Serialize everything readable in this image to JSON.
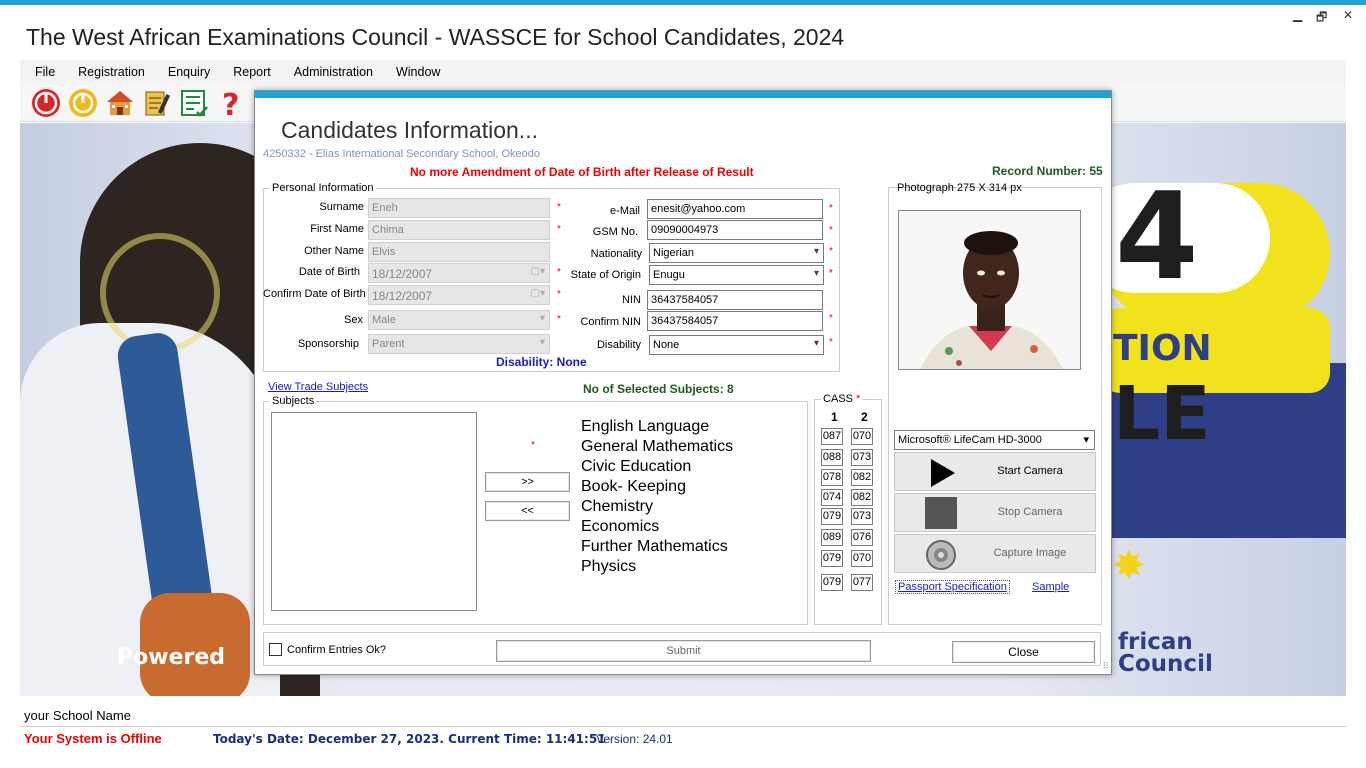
{
  "app": {
    "title": "The West African Examinations Council - WASSCE for School Candidates, 2024",
    "window_controls": [
      "▁",
      "🗗",
      "✕"
    ]
  },
  "menu": [
    "File",
    "Registration",
    "Enquiry",
    "Report",
    "Administration",
    "Window"
  ],
  "toolbar": {
    "icons": [
      "power-icon",
      "logoff-icon",
      "school-icon",
      "edit-form-icon",
      "checklist-icon",
      "help-icon"
    ]
  },
  "background": {
    "powered": "Powered",
    "digit": "4",
    "tion": "TION",
    "le": "LE",
    "council_line1": "frican",
    "council_line2": "Council"
  },
  "dialog": {
    "title": "Candidates Information...",
    "school": "4250332 - Elias International Secondary School, Okeodo",
    "warning": "No more Amendment of Date of Birth after Release of Result",
    "record_number": "Record Number: 55",
    "personal_legend": "Personal Information",
    "labels": {
      "surname": "Surname",
      "first_name": "First Name",
      "other_name": "Other Name",
      "dob": "Date of Birth",
      "confirm_dob": "Confirm Date of Birth",
      "sex": "Sex",
      "sponsorship": "Sponsorship",
      "email": "e-Mail",
      "gsm": "GSM No.",
      "nationality": "Nationality",
      "state": "State of Origin",
      "nin": "NIN",
      "confirm_nin": "Confirm NIN",
      "disability": "Disability"
    },
    "values": {
      "surname": "Eneh",
      "first_name": "Chima",
      "other_name": "Elvis",
      "dob": "18/12/2007",
      "confirm_dob": "18/12/2007",
      "sex": "Male",
      "sponsorship": "Parent",
      "email": "enesit@yahoo.com",
      "gsm": "09090004973",
      "nationality": "Nigerian",
      "state": "Enugu",
      "nin": "36437584057",
      "confirm_nin": "36437584057",
      "disability": "None"
    },
    "disability_summary": "Disability: None",
    "view_trade": "View Trade Subjects",
    "selected_count": "No of Selected Subjects: 8",
    "subjects_legend": "Subjects",
    "move_right": ">>",
    "move_left": "<<",
    "selected_subjects": [
      "English Language",
      "General Mathematics",
      "Civic Education",
      "Book- Keeping",
      "Chemistry",
      "Economics",
      "Further Mathematics",
      "Physics"
    ],
    "cass_legend": "CASS",
    "cass_col1": "1",
    "cass_col2": "2",
    "cass": [
      [
        "087",
        "070"
      ],
      [
        "088",
        "073"
      ],
      [
        "078",
        "082"
      ],
      [
        "074",
        "082"
      ],
      [
        "079",
        "073"
      ],
      [
        "089",
        "076"
      ],
      [
        "079",
        "070"
      ],
      [
        "079",
        "077"
      ]
    ],
    "photo_label": "Photograph 275 X 314  px",
    "camera": "Microsoft® LifeCam HD-3000",
    "start_camera": "Start Camera",
    "stop_camera": "Stop Camera",
    "capture_image": "Capture Image",
    "passport_spec": "Passport Specification",
    "sample": "Sample",
    "confirm_entries": "Confirm Entries Ok?",
    "submit": "Submit",
    "close": "Close"
  },
  "status": {
    "school_name": "your School Name",
    "offline": "Your System is Offline",
    "date_time": "Today's Date: December 27, 2023. Current Time: 11:41:51",
    "version": "Version: 24.01"
  }
}
